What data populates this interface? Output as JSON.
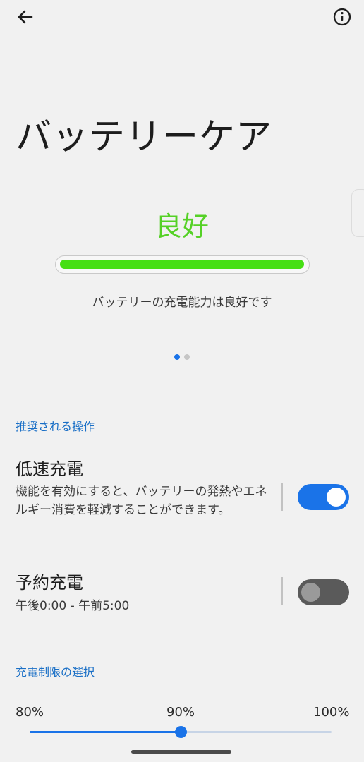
{
  "header": {
    "back_icon": "arrow-left-icon",
    "info_icon": "info-circle-icon"
  },
  "page": {
    "title": "バッテリーケア"
  },
  "battery": {
    "status": "良好",
    "health_fraction": 1.0,
    "description": "バッテリーの充電能力は良好です",
    "pager_pages": 2,
    "pager_current": 1
  },
  "recommended": {
    "header": "推奨される操作",
    "slow_charging": {
      "title": "低速充電",
      "description": "機能を有効にすると、バッテリーの発熱やエネルギー消費を軽減することができます。",
      "enabled": true
    },
    "scheduled_charging": {
      "title": "予約充電",
      "description": "午後0:00 - 午前5:00",
      "enabled": false
    }
  },
  "charge_limit": {
    "header": "充電制限の選択",
    "min_label": "80%",
    "mid_label": "90%",
    "max_label": "100%",
    "min": 80,
    "max": 100,
    "value": 90
  },
  "colors": {
    "accent": "#1a73e8",
    "good": "#55d126",
    "bar_fill": "#46df14",
    "background": "#f1f1f1"
  }
}
